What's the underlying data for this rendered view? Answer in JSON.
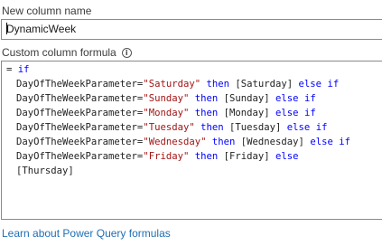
{
  "name_label": "New column name",
  "name_value": "DynamicWeek",
  "formula_label": "Custom column formula",
  "learn_link": "Learn about Power Query formulas",
  "formula": {
    "line1": {
      "eq": "= ",
      "kw": "if"
    },
    "lines": [
      {
        "param": "DayOfTheWeekParameter=",
        "str": "\"Saturday\"",
        "then": " then ",
        "col": "[Saturday]",
        "tail": " else if"
      },
      {
        "param": "DayOfTheWeekParameter=",
        "str": "\"Sunday\"",
        "then": " then ",
        "col": "[Sunday]",
        "tail": " else if"
      },
      {
        "param": "DayOfTheWeekParameter=",
        "str": "\"Monday\"",
        "then": " then ",
        "col": "[Monday]",
        "tail": " else if"
      },
      {
        "param": "DayOfTheWeekParameter=",
        "str": "\"Tuesday\"",
        "then": " then ",
        "col": "[Tuesday]",
        "tail": " else if"
      },
      {
        "param": "DayOfTheWeekParameter=",
        "str": "\"Wednesday\"",
        "then": " then ",
        "col": "[Wednesday]",
        "tail": " else if"
      },
      {
        "param": "DayOfTheWeekParameter=",
        "str": "\"Friday\"",
        "then": " then ",
        "col": "[Friday]",
        "tail": " else"
      }
    ],
    "last": "[Thursday]"
  },
  "colors": {
    "keyword": "#0000ff",
    "string": "#a31515",
    "link": "#1f6fb5"
  },
  "icons": {
    "info": "info-icon"
  }
}
